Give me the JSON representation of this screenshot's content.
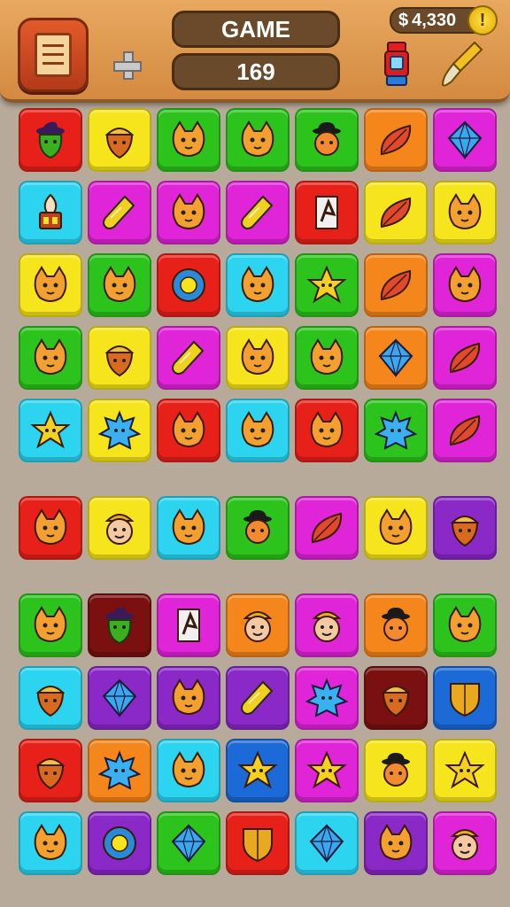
{
  "hud": {
    "title": "GAME",
    "score": "169",
    "currency_symbol": "$",
    "currency": "4,330",
    "coin_glyph": "!"
  },
  "icons": {
    "menu": "notepad-icon",
    "add": "plus-icon",
    "coin": "coin-icon",
    "powerup_1": "lantern-icon",
    "powerup_2": "paintbrush-icon"
  },
  "palette": {
    "red": "#e8201a",
    "yellow": "#f6e41c",
    "green": "#2cc41c",
    "orange": "#f4861c",
    "magenta": "#e024d8",
    "cyan": "#2cd4f0",
    "purple": "#8a28c8",
    "darkred": "#7a1010",
    "blue": "#1c6ad8"
  },
  "board": {
    "rows": [
      [
        {
          "bg": "red",
          "icon": "witch"
        },
        {
          "bg": "yellow",
          "icon": "acorn"
        },
        {
          "bg": "green",
          "icon": "cat"
        },
        {
          "bg": "green",
          "icon": "cat"
        },
        {
          "bg": "green",
          "icon": "bowler"
        },
        {
          "bg": "orange",
          "icon": "leaf"
        },
        {
          "bg": "magenta",
          "icon": "gem"
        }
      ],
      [
        {
          "bg": "cyan",
          "icon": "torch"
        },
        {
          "bg": "magenta",
          "icon": "bottle"
        },
        {
          "bg": "magenta",
          "icon": "cat"
        },
        {
          "bg": "magenta",
          "icon": "bottle"
        },
        {
          "bg": "red",
          "icon": "rune"
        },
        {
          "bg": "yellow",
          "icon": "leaf"
        },
        {
          "bg": "yellow",
          "icon": "cat"
        }
      ],
      [
        {
          "bg": "yellow",
          "icon": "cat"
        },
        {
          "bg": "green",
          "icon": "cat"
        },
        {
          "bg": "red",
          "icon": "orb"
        },
        {
          "bg": "cyan",
          "icon": "cat"
        },
        {
          "bg": "green",
          "icon": "star"
        },
        {
          "bg": "orange",
          "icon": "leaf"
        },
        {
          "bg": "magenta",
          "icon": "cat"
        }
      ],
      [
        {
          "bg": "green",
          "icon": "cat"
        },
        {
          "bg": "yellow",
          "icon": "acorn"
        },
        {
          "bg": "magenta",
          "icon": "bottle"
        },
        {
          "bg": "yellow",
          "icon": "cat"
        },
        {
          "bg": "green",
          "icon": "cat"
        },
        {
          "bg": "orange",
          "icon": "gem"
        },
        {
          "bg": "magenta",
          "icon": "leaf"
        }
      ],
      [
        {
          "bg": "cyan",
          "icon": "star"
        },
        {
          "bg": "yellow",
          "icon": "spiky"
        },
        {
          "bg": "red",
          "icon": "cat"
        },
        {
          "bg": "cyan",
          "icon": "cat"
        },
        {
          "bg": "red",
          "icon": "cat"
        },
        {
          "bg": "green",
          "icon": "spiky"
        },
        {
          "bg": "magenta",
          "icon": "leaf"
        }
      ],
      [
        {
          "bg": "red",
          "icon": "cat"
        },
        {
          "bg": "yellow",
          "icon": "face"
        },
        {
          "bg": "cyan",
          "icon": "cat"
        },
        {
          "bg": "green",
          "icon": "bowler"
        },
        {
          "bg": "magenta",
          "icon": "leaf"
        },
        {
          "bg": "yellow",
          "icon": "cat"
        },
        {
          "bg": "purple",
          "icon": "acorn"
        }
      ],
      [
        {
          "bg": "green",
          "icon": "cat"
        },
        {
          "bg": "darkred",
          "icon": "witch"
        },
        {
          "bg": "magenta",
          "icon": "rune"
        },
        {
          "bg": "orange",
          "icon": "face"
        },
        {
          "bg": "magenta",
          "icon": "face"
        },
        {
          "bg": "orange",
          "icon": "bowler"
        },
        {
          "bg": "green",
          "icon": "cat"
        }
      ],
      [
        {
          "bg": "cyan",
          "icon": "acorn"
        },
        {
          "bg": "purple",
          "icon": "gem"
        },
        {
          "bg": "purple",
          "icon": "cat"
        },
        {
          "bg": "purple",
          "icon": "bottle"
        },
        {
          "bg": "magenta",
          "icon": "spiky"
        },
        {
          "bg": "darkred",
          "icon": "acorn"
        },
        {
          "bg": "blue",
          "icon": "shield"
        }
      ],
      [
        {
          "bg": "red",
          "icon": "acorn"
        },
        {
          "bg": "orange",
          "icon": "spiky"
        },
        {
          "bg": "cyan",
          "icon": "cat"
        },
        {
          "bg": "blue",
          "icon": "star"
        },
        {
          "bg": "magenta",
          "icon": "star"
        },
        {
          "bg": "yellow",
          "icon": "bowler"
        },
        {
          "bg": "yellow",
          "icon": "star"
        }
      ],
      [
        {
          "bg": "cyan",
          "icon": "cat"
        },
        {
          "bg": "purple",
          "icon": "orb"
        },
        {
          "bg": "green",
          "icon": "gem"
        },
        {
          "bg": "red",
          "icon": "shield"
        },
        {
          "bg": "cyan",
          "icon": "gem"
        },
        {
          "bg": "purple",
          "icon": "cat"
        },
        {
          "bg": "magenta",
          "icon": "face"
        }
      ]
    ]
  }
}
